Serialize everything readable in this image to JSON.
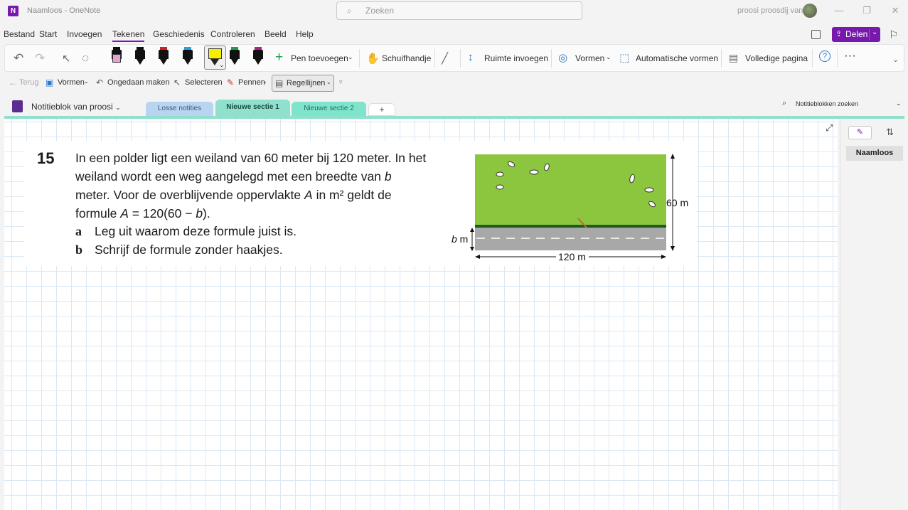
{
  "window": {
    "app_logo": "N",
    "title": "Naamloos - OneNote",
    "search_placeholder": "Zoeken",
    "user_name": "proosi proosdij van"
  },
  "menu": {
    "items": [
      "Bestand",
      "Start",
      "Invoegen",
      "Tekenen",
      "Geschiedenis",
      "Controleren",
      "Beeld",
      "Help"
    ],
    "active": "Tekenen",
    "share_label": "Delen"
  },
  "ribbon": {
    "add_pen": "Pen toevoegen",
    "pan": "Schuifhandje",
    "insert_space": "Ruimte invoegen",
    "shapes": "Vormen",
    "auto_shapes": "Automatische vormen",
    "full_page": "Volledige pagina",
    "help_glyph": "?",
    "more_glyph": "⋯",
    "pen_colors": [
      "#e8a0d0",
      "#111111",
      "#d42020",
      "#2aa0e0",
      "#1aa050",
      "#b0208a"
    ],
    "highlighter_color": "#f5f000"
  },
  "toolbar2": {
    "back": "Terug",
    "shapes": "Vormen",
    "undo": "Ongedaan maken",
    "select": "Selecteren",
    "pens": "Pennen",
    "rule_lines": "Regellijnen"
  },
  "notebook": {
    "name": "Notitieblok van proosi",
    "sections": [
      "Losse notities",
      "Nieuwe sectie 1",
      "Nieuwe sectie 2"
    ],
    "active_section": "Nieuwe sectie 1",
    "add_section": "+",
    "search_placeholder": "Notitieblokken zoeken"
  },
  "exercise": {
    "number": "15",
    "lines": [
      "In een polder ligt een weiland van 60 meter bij 120 meter. In het",
      "weiland wordt een weg aangelegd met een breedte van",
      "meter. Voor de overblijvende oppervlakte",
      "formule"
    ],
    "var_b": "b",
    "var_A": "A",
    "line3_tail": "in m² geldt de",
    "formula_tail": " = 120(60 − ",
    "formula_end": ").",
    "subs": [
      {
        "letter": "a",
        "text": "Leg uit waarom deze formule juist is."
      },
      {
        "letter": "b",
        "text": "Schrijf de formule zonder haakjes."
      }
    ]
  },
  "figure": {
    "height_label": "60 m",
    "width_label": "120 m",
    "road_label_var": "b",
    "road_label_unit": " m",
    "grass_color": "#8cc63f",
    "road_color": "#a8a8a8"
  },
  "right_panel": {
    "page_title": "Naamloos"
  }
}
